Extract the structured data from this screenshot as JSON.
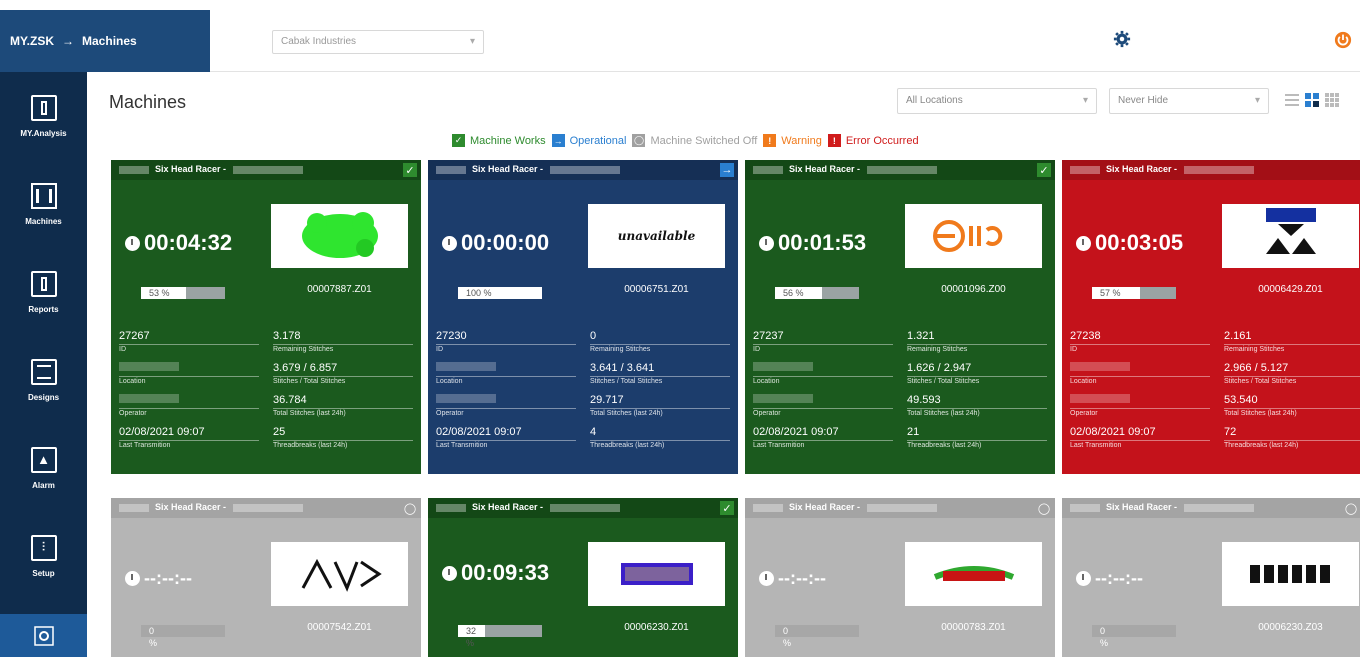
{
  "header": {
    "brand": "MY.ZSK",
    "arrow": "→",
    "crumb": "Machines",
    "filter_placeholder": "Cabak Industries"
  },
  "sidebar": {
    "items": [
      {
        "label": "MY.Analysis",
        "icon": "analysis-icon"
      },
      {
        "label": "Machines",
        "icon": "machines-icon"
      },
      {
        "label": "Reports",
        "icon": "reports-icon"
      },
      {
        "label": "Designs",
        "icon": "designs-icon"
      },
      {
        "label": "Alarm",
        "icon": "alarm-icon"
      },
      {
        "label": "Setup",
        "icon": "setup-icon"
      }
    ]
  },
  "main": {
    "title": "Machines",
    "location_select": "All Locations",
    "hide_select": "Never Hide",
    "legend": [
      {
        "label": "Machine Works",
        "color": "#2e8b2e",
        "glyph": "✓"
      },
      {
        "label": "Operational",
        "color": "#2a7fd0",
        "glyph": "→"
      },
      {
        "label": "Machine Switched Off",
        "color": "#a0a0a0",
        "glyph": "◯"
      },
      {
        "label": "Warning",
        "color": "#f07a1c",
        "glyph": "!"
      },
      {
        "label": "Error Occurred",
        "color": "#d01c1c",
        "glyph": "!"
      }
    ]
  },
  "cards": [
    {
      "name": "Six Head Racer - ",
      "time": "00:04:32",
      "progress_label": "53 %",
      "progress": 53,
      "file": "00007887.Z01",
      "id": "27267",
      "remaining": "3.178",
      "stitches": "3.679 / 6.857",
      "total24": "36.784",
      "last": "02/08/2021 09:07",
      "thread": "25"
    },
    {
      "name": "Six Head Racer - ",
      "time": "00:00:00",
      "progress_label": "100 %",
      "progress": 100,
      "file": "00006751.Z01",
      "id": "27230",
      "remaining": "0",
      "stitches": "3.641 / 3.641",
      "total24": "29.717",
      "last": "02/08/2021 09:07",
      "thread": "4",
      "thumb_text": "unavailable"
    },
    {
      "name": "Six Head Racer - ",
      "time": "00:01:53",
      "progress_label": "56 %",
      "progress": 56,
      "file": "00001096.Z00",
      "id": "27237",
      "remaining": "1.321",
      "stitches": "1.626 / 2.947",
      "total24": "49.593",
      "last": "02/08/2021 09:07",
      "thread": "21"
    },
    {
      "name": "Six Head Racer - ",
      "time": "00:03:05",
      "progress_label": "57 %",
      "progress": 57,
      "file": "00006429.Z01",
      "id": "27238",
      "remaining": "2.161",
      "stitches": "2.966 / 5.127",
      "total24": "53.540",
      "last": "02/08/2021 09:07",
      "thread": "72"
    },
    {
      "name": "Six Head Racer - ",
      "time": "--:--:--",
      "progress_label": "0 %",
      "progress": 0,
      "file": "00007542.Z01"
    },
    {
      "name": "Six Head Racer - ",
      "time": "00:09:33",
      "progress_label": "32 %",
      "progress": 32,
      "file": "00006230.Z01"
    },
    {
      "name": "Six Head Racer - ",
      "time": "--:--:--",
      "progress_label": "0 %",
      "progress": 0,
      "file": "00000783.Z01"
    },
    {
      "name": "Six Head Racer - ",
      "time": "--:--:--",
      "progress_label": "0 %",
      "progress": 0,
      "file": "00006230.Z03"
    }
  ],
  "stat_labels": {
    "id": "ID",
    "remaining": "Remaining Stitches",
    "location": "Location",
    "stitches": "Stitches / Total Stitches",
    "operator": "Operator",
    "total24": "Total Stitches (last 24h)",
    "last": "Last Transmition",
    "thread": "Threadbreaks (last 24h)"
  }
}
